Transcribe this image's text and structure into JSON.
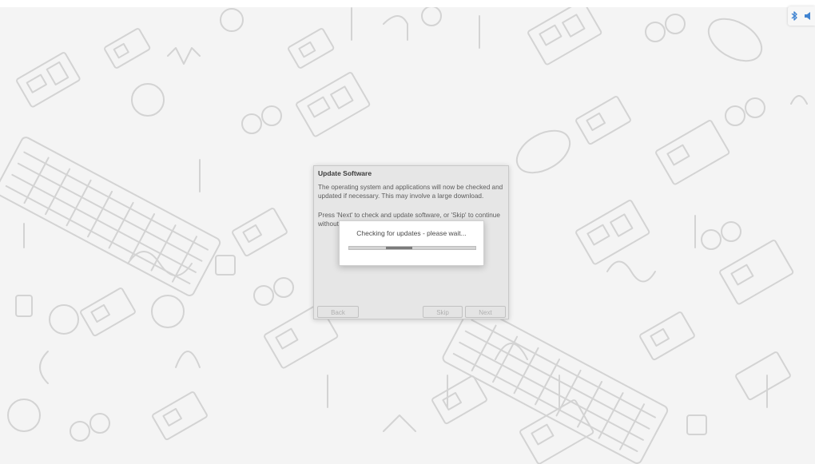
{
  "desktop": {
    "wallpaper_icon": "raspberry-pi-hardware-line-art",
    "tray": {
      "bluetooth_icon": "bluetooth-icon",
      "volume_icon": "volume-icon",
      "accent_color": "#3a7fd0"
    }
  },
  "wizard": {
    "title": "Update Software",
    "paragraph1": "The operating system and applications will now be checked and updated if necessary. This may involve a large download.",
    "paragraph2": "Press 'Next' to check and update software, or 'Skip' to continue without checking.",
    "buttons": {
      "back": "Back",
      "skip": "Skip",
      "next": "Next"
    }
  },
  "progress_dialog": {
    "message": "Checking for updates - please wait...",
    "mode": "indeterminate"
  }
}
